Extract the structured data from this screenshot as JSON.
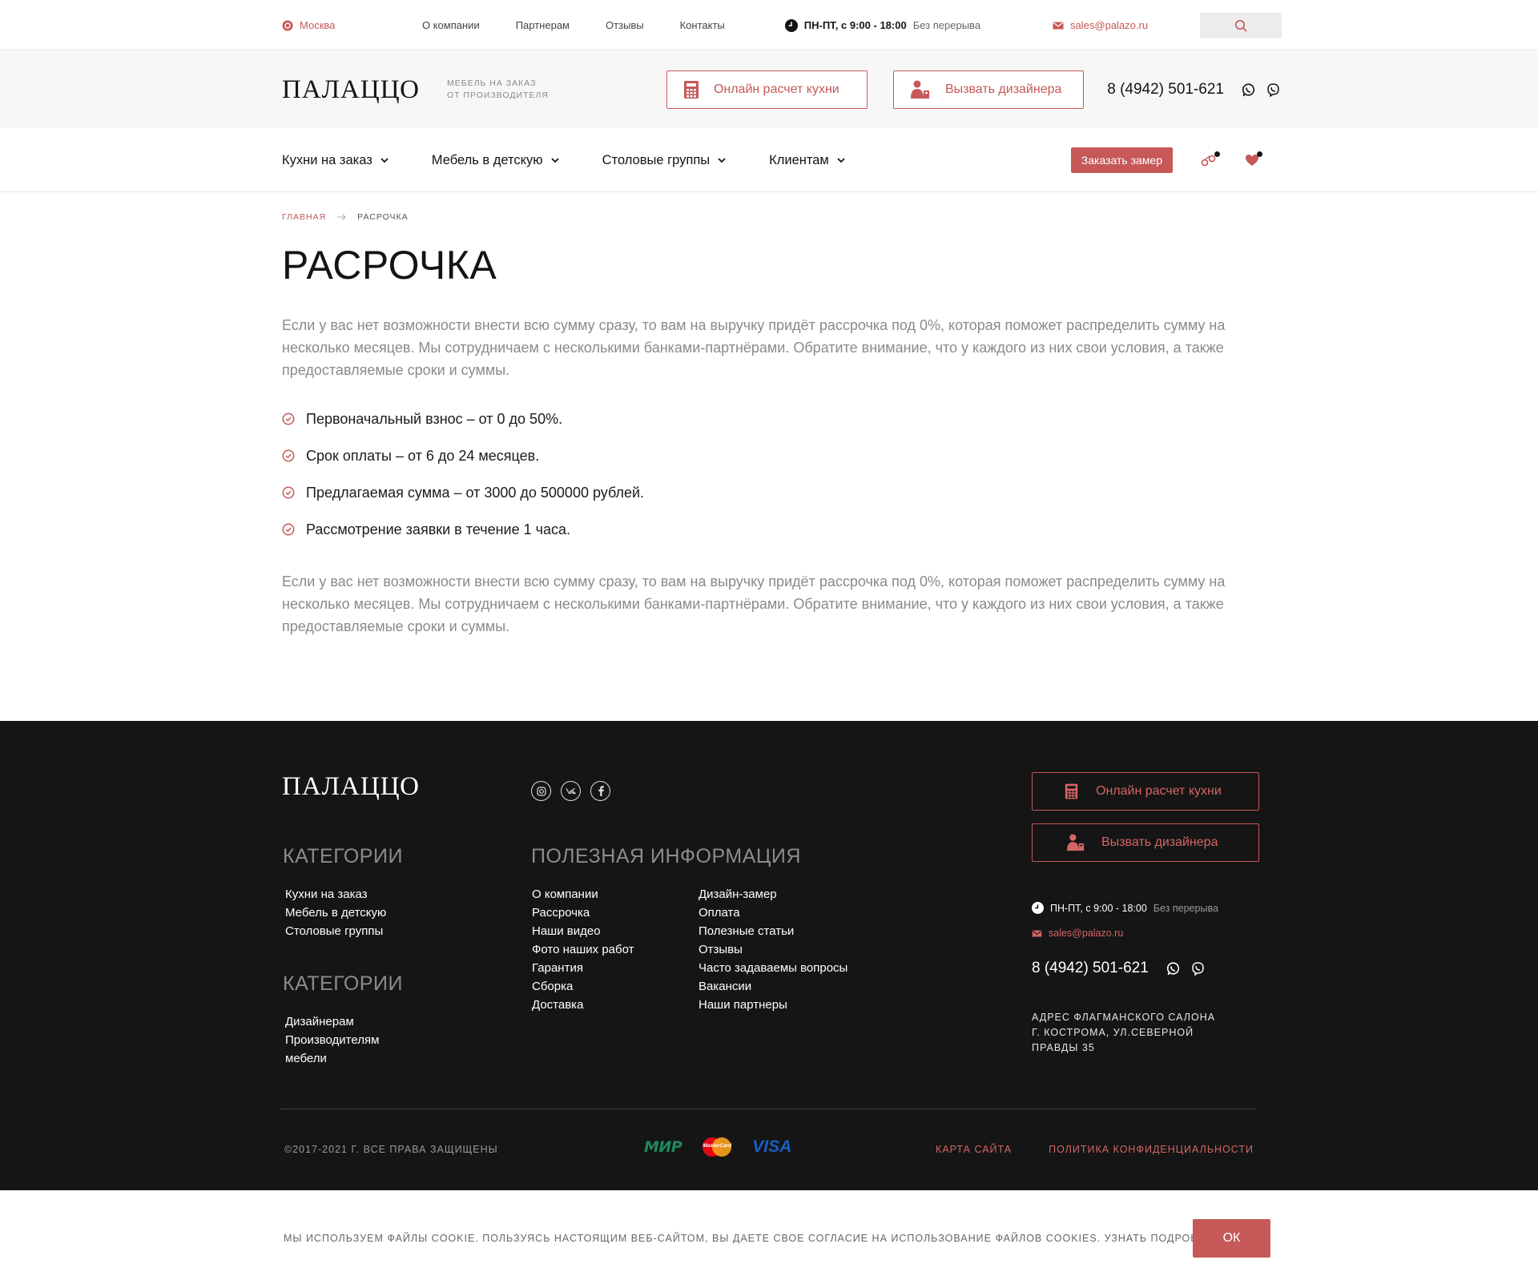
{
  "topbar": {
    "city": "Москва",
    "nav": [
      "О компании",
      "Партнерам",
      "Отзывы",
      "Контакты"
    ],
    "hours_bold": "ПН-ПТ, с 9:00 - 18:00",
    "hours_note": "Без перерыва",
    "email": "sales@palazo.ru"
  },
  "header": {
    "logo": "ПАЛАЦЦО",
    "tagline_line1": "Мебель на заказ",
    "tagline_line2": "от производителя",
    "calc_button": "Онлайн расчет кухни",
    "designer_button": "Вызвать дизайнера",
    "phone": "8 (4942) 501-621"
  },
  "nav": {
    "items": [
      "Кухни на заказ",
      "Мебель в детскую",
      "Столовые группы",
      "Клиентам"
    ],
    "order_button": "Заказать замер"
  },
  "breadcrumb": {
    "home": "ГЛАВНАЯ",
    "current": "РАСРОЧКА"
  },
  "content": {
    "title": "РАСРОЧКА",
    "paragraph1": "Если у вас нет возможности внести всю сумму сразу, то вам на выручку придёт рассрочка под 0%, которая поможет распределить сумму на несколько месяцев. Мы сотрудничаем с несколькими банками-партнёрами. Обратите внимание, что у каждого из них свои условия, а также предоставляемые сроки и суммы.",
    "checklist": [
      "Первоначальный взнос – от 0 до 50%.",
      "Срок оплаты – от 6 до 24 месяцев.",
      "Предлагаемая сумма – от 3000 до 500000 рублей.",
      "Рассмотрение заявки в течение 1 часа."
    ],
    "paragraph2": "Если у вас нет возможности внести всю сумму сразу, то вам на выручку придёт рассрочка под 0%, которая поможет распределить сумму на несколько месяцев. Мы сотрудничаем с несколькими банками-партнёрами. Обратите внимание, что у каждого из них свои условия, а также предоставляемые сроки и суммы."
  },
  "footer": {
    "logo": "ПАЛАЦЦО",
    "categories_heading": "КАТЕГОРИИ",
    "categories": [
      "Кухни на заказ",
      "Мебель в детскую",
      "Столовые группы"
    ],
    "categories2_heading": "КАТЕГОРИИ",
    "categories2": [
      "Дизайнерам",
      "Производителям",
      "мебели"
    ],
    "useful_heading": "ПОЛЕЗНАЯ ИНФОРМАЦИЯ",
    "useful_col1": [
      "О компании",
      "Рассрочка",
      "Наши видео",
      "Фото наших работ",
      "Гарантия",
      "Сборка",
      "Доставка"
    ],
    "useful_col2": [
      "Дизайн-замер",
      "Оплата",
      "Полезные статьи",
      "Отзывы",
      "Часто задаваемы вопросы",
      "Вакансии",
      "Наши партнеры"
    ],
    "calc_button": "Онлайн расчет кухни",
    "designer_button": "Вызвать дизайнера",
    "hours_bold": "ПН-ПТ, с 9:00 - 18:00",
    "hours_note": "Без перерыва",
    "email": "sales@palazo.ru",
    "phone": "8 (4942) 501-621",
    "address": "Адрес флагманского салона г. Кострома, ул.Северной Правды 35",
    "copyright": "©2017-2021 Г. ВСЕ ПРАВА ЗАЩИЩЕНЫ",
    "payment_mir": "МИР",
    "payment_mastercard": "MasterCard",
    "payment_visa": "VISA",
    "sitemap": "КАРТА САЙТА",
    "privacy": "ПОЛИТИКА КОНФИДЕНЦИАЛЬНОСТИ"
  },
  "cookie": {
    "text": "МЫ ИСПОЛЬЗУЕМ ФАЙЛЫ COOKIE. ПОЛЬЗУЯСЬ НАСТОЯЩИМ ВЕБ-САЙТОМ, ВЫ ДАЕТЕ СВОЕ СОГЛАСИЕ НА ИСПОЛЬЗОВАНИЕ ФАЙЛОВ COOKIES. УЗНАТЬ ПОДРОБНЕЕ",
    "ok": "ОК"
  },
  "colors": {
    "accent": "#c65858",
    "footer_bg": "#151515",
    "header_bg": "#f7f7f7"
  },
  "icons": [
    "location-pin-icon",
    "clock-icon",
    "mail-icon",
    "search-icon",
    "calculator-icon",
    "designer-icon",
    "whatsapp-icon",
    "viber-icon",
    "chevron-down-icon",
    "compare-icon",
    "heart-icon",
    "check-circle-icon",
    "instagram-icon",
    "vk-icon",
    "facebook-icon"
  ]
}
